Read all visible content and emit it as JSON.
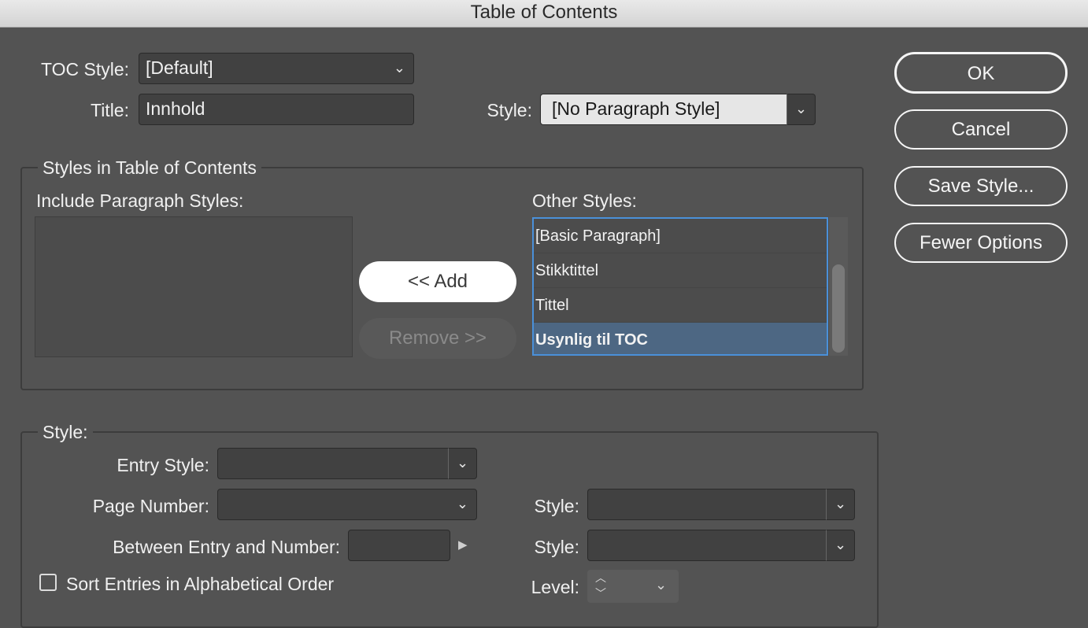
{
  "window": {
    "title": "Table of Contents"
  },
  "top": {
    "toc_style_label": "TOC Style:",
    "toc_style_value": "[Default]",
    "title_label": "Title:",
    "title_value": "Innhold",
    "style_label": "Style:",
    "style_value": "[No Paragraph Style]"
  },
  "buttons": {
    "ok": "OK",
    "cancel": "Cancel",
    "save_style": "Save Style...",
    "fewer_options": "Fewer Options"
  },
  "styles_group": {
    "legend": "Styles in Table of Contents",
    "include_label": "Include Paragraph Styles:",
    "other_label": "Other Styles:",
    "add_label": "<< Add",
    "remove_label": "Remove >>",
    "other_styles": [
      {
        "label": "[Basic Paragraph]",
        "selected": false
      },
      {
        "label": "Stikktittel",
        "selected": false
      },
      {
        "label": "Tittel",
        "selected": false
      },
      {
        "label": "Usynlig til TOC",
        "selected": true
      }
    ]
  },
  "style_group": {
    "legend": "Style:",
    "entry_style_label": "Entry Style:",
    "page_number_label": "Page Number:",
    "page_style_label": "Style:",
    "between_label": "Between Entry and Number:",
    "between_style_label": "Style:",
    "sort_label": "Sort Entries in Alphabetical Order",
    "sort_checked": false,
    "level_label": "Level:"
  },
  "icons": {
    "chevron": "⌄",
    "triangle_right": "▶",
    "up": "︿",
    "down": "﹀"
  },
  "colors": {
    "background": "#535353",
    "selection": "#4d6783",
    "focus": "#4a90d9"
  }
}
